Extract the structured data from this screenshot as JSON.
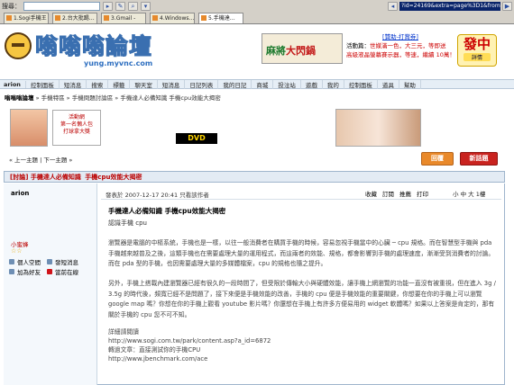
{
  "browser": {
    "search_label": "搜尋：",
    "url": "?id=24169&extra=page%3D1&frombbs=1",
    "tabs": [
      {
        "label": "1.Sogi手機王",
        "active": false
      },
      {
        "label": "2.台大批踢…",
        "active": false
      },
      {
        "label": "3.Gmail -",
        "active": false
      },
      {
        "label": "4.Windows…",
        "active": false
      },
      {
        "label": "5.手機達…",
        "active": true
      }
    ]
  },
  "header": {
    "logo_title": "嗡嗡嗡論壇",
    "logo_url": "yung.myvnc.com",
    "ad_mahjong_1": "麻將",
    "ad_mahjong_2": "大閃鍋",
    "ad_links_title": "[贊助-打賞券]",
    "ad_links_row1_a": "活動篇：",
    "ad_links_row1_b": "世媒滿一色，大三元，等即送",
    "ad_links_row2": "高級液晶螢幕賽示器，等速，繼續 10萬！",
    "badge_big": "發中",
    "badge_small": "詳情"
  },
  "nav": {
    "user": "arion",
    "items": [
      "控制面板",
      "短消息",
      "搜索",
      "標籤",
      "聊天室",
      "短消息",
      "日記列表",
      "我的日記",
      "商城",
      "投注站",
      "遊戲",
      "我的",
      "控制面板",
      "道具",
      "幫助"
    ]
  },
  "breadcrumb": {
    "site": "嗡嗡嗡論壇",
    "sep1": " » ",
    "l1": "手機特區",
    "sep2": " » ",
    "l2": "手機問題討論區",
    "sep3": " » ",
    "l3": "手機達人必備知識",
    "sep4": " ",
    "l4": "手機cpu效能大揭密"
  },
  "ads": {
    "girl_text": "活動網\n第一名懶人包\n打球拿大獎",
    "dvd_text": "DVD"
  },
  "thread": {
    "prevnext": "« 上一主題 | 下一主題 »",
    "reply_label": "回覆",
    "new_label": "新話題",
    "title_tag": "[討論] 手機達人必備知識",
    "title_text": "手機cpu效能大揭密"
  },
  "post": {
    "author": "arion",
    "user_title": "小蜜蜂",
    "stars": "☆☆",
    "actions": [
      "個人空間",
      "發短消息",
      "加為好友",
      "當前在線"
    ],
    "meta": "發表於 2007-12-17 20:41  只看該作者",
    "tools": [
      "收藏",
      "訂閱",
      "推薦",
      "打印"
    ],
    "tools2": "小  中  大  1樓",
    "title": "手機達人必備知識    手機cpu效能大揭密",
    "subtitle": "認識手機 cpu",
    "para1": "瀏覽器是電腦的中樞系統，手機也是一樣，以往一般消費者在購買手機的時候，容易忽視手機當中的心臟 ─ cpu 規格。而在智慧型手機與 pda 手機越來越普及之後，這類手機也在需要處理大量的運用程式，而這兩者的效能、規格，都會影響到手機的處理速度，漸漸受到消費者的討論。而在 pda 型的手機，也因需要處理大量的多媒體檔案，cpu 的規格也隨之提升。",
    "para2": "另外，手機上搭載內建瀏覽器已經有很久的一段時間了，但受限於傳輸大小與硬體效能，讓手機上網瀏覽的功能一直沒有被重視，但在進入 3g / 3.5g 的時代後，頻寬已經不是問題了，接下來便是手機效能的改善，手機的 cpu 便是手機效能的重要關鍵，你想要在你的手機上可以瀏覽 google map 嗎？你想在你的手機上觀看 youtube 影片嗎？你還想在手機上有許多方便易用的 widget 軟體嗎？如果以上答案是肯定的，那有關於手機的 cpu 您不可不知。",
    "links_head": "詳細請閱讀",
    "link1": "http://www.sogi.com.tw/park/content.asp?a_id=6872",
    "link1_label": "轉過文章：直接測試你的手機CPU",
    "link2": "http://www.jbenchmark.com/ace"
  }
}
